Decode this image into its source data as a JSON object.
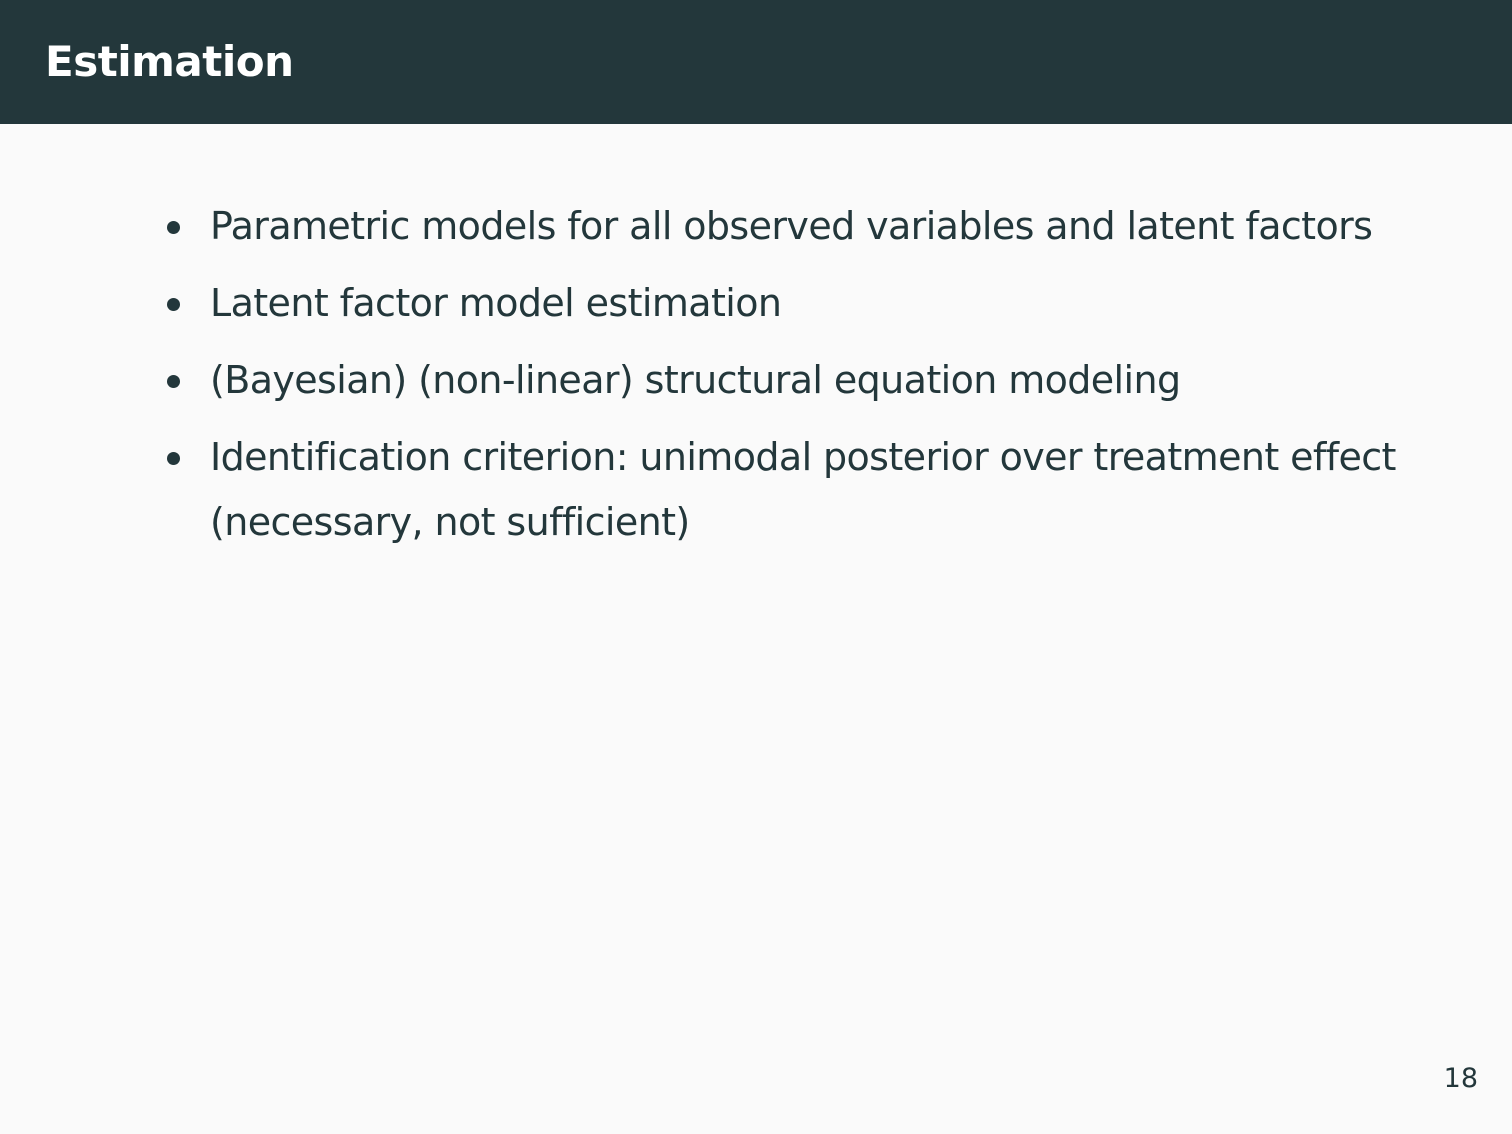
{
  "slide": {
    "title": "Estimation",
    "bullets": [
      "Parametric models for all observed variables and latent factors",
      "Latent factor model estimation",
      "(Bayesian) (non-linear) structural equation modeling",
      "Identification criterion: unimodal posterior over treatment effect (necessary, not sufficient)"
    ],
    "page_number": "18"
  },
  "colors": {
    "header_background": "#23373b",
    "header_text": "#ffffff",
    "body_background": "#fafafa",
    "body_text": "#23373b"
  }
}
